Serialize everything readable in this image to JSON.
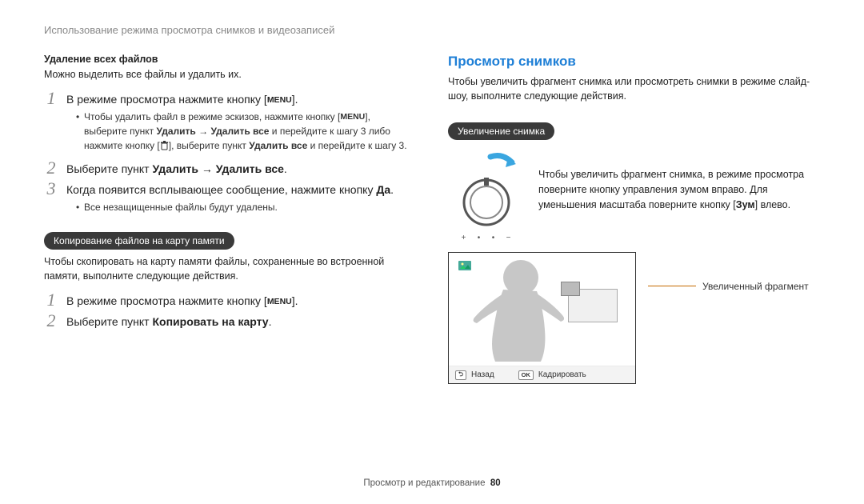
{
  "breadcrumb": "Использование режима просмотра снимков и видеозаписей",
  "left": {
    "sub1_title": "Удаление всех файлов",
    "sub1_text": "Можно выделить все файлы и удалить их.",
    "step1_prefix": "В режиме просмотра нажмите кнопку [",
    "step1_suffix": "].",
    "bullet1_prefix": "Чтобы удалить файл в режиме эскизов, нажмите кнопку [",
    "bullet1_mid": "], выберите пункт ",
    "bullet1_b1": "Удалить",
    "arrow": " → ",
    "bullet1_b2": "Удалить все",
    "bullet1_mid2": " и перейдите к шагу 3 либо нажмите кнопку [",
    "bullet1_mid3": "], выберите пункт ",
    "bullet1_b3": "Удалить все",
    "bullet1_end": " и перейдите к шагу 3.",
    "step2_prefix": "Выберите пункт ",
    "step2_b1": "Удалить",
    "step2_b2": "Удалить все",
    "step2_suffix": ".",
    "step3_prefix": "Когда появится всплывающее сообщение, нажмите кнопку ",
    "step3_b": "Да",
    "step3_suffix": ".",
    "bullet3": "Все незащищенные файлы будут удалены.",
    "pill2": "Копирование файлов на карту памяти",
    "copy_intro": "Чтобы скопировать на карту памяти файлы, сохраненные во встроенной памяти, выполните следующие действия.",
    "copy_step1_prefix": "В режиме просмотра нажмите кнопку [",
    "copy_step1_suffix": "].",
    "copy_step2_prefix": "Выберите пункт ",
    "copy_step2_b": "Копировать на карту",
    "copy_step2_suffix": "."
  },
  "right": {
    "heading": "Просмотр снимков",
    "intro": "Чтобы увеличить фрагмент снимка или просмотреть снимки в режиме слайд-шоу, выполните следующие действия.",
    "pill": "Увеличение снимка",
    "zoom_text_prefix": "Чтобы увеличить фрагмент снимка, в режиме просмотра поверните кнопку управления зумом вправо. Для уменьшения масштаба поверните кнопку [",
    "zoom_b": "Зум",
    "zoom_text_suffix": "] влево.",
    "plus": "+",
    "dot": "•",
    "minus": "−",
    "callout": "Увеличенный фрагмент",
    "footer_back_key": "⮌",
    "footer_back": "Назад",
    "footer_crop_key": "OK",
    "footer_crop": "Кадрировать"
  },
  "footer": {
    "section": "Просмотр и редактирование",
    "page": "80"
  },
  "menu_label": "MENU"
}
